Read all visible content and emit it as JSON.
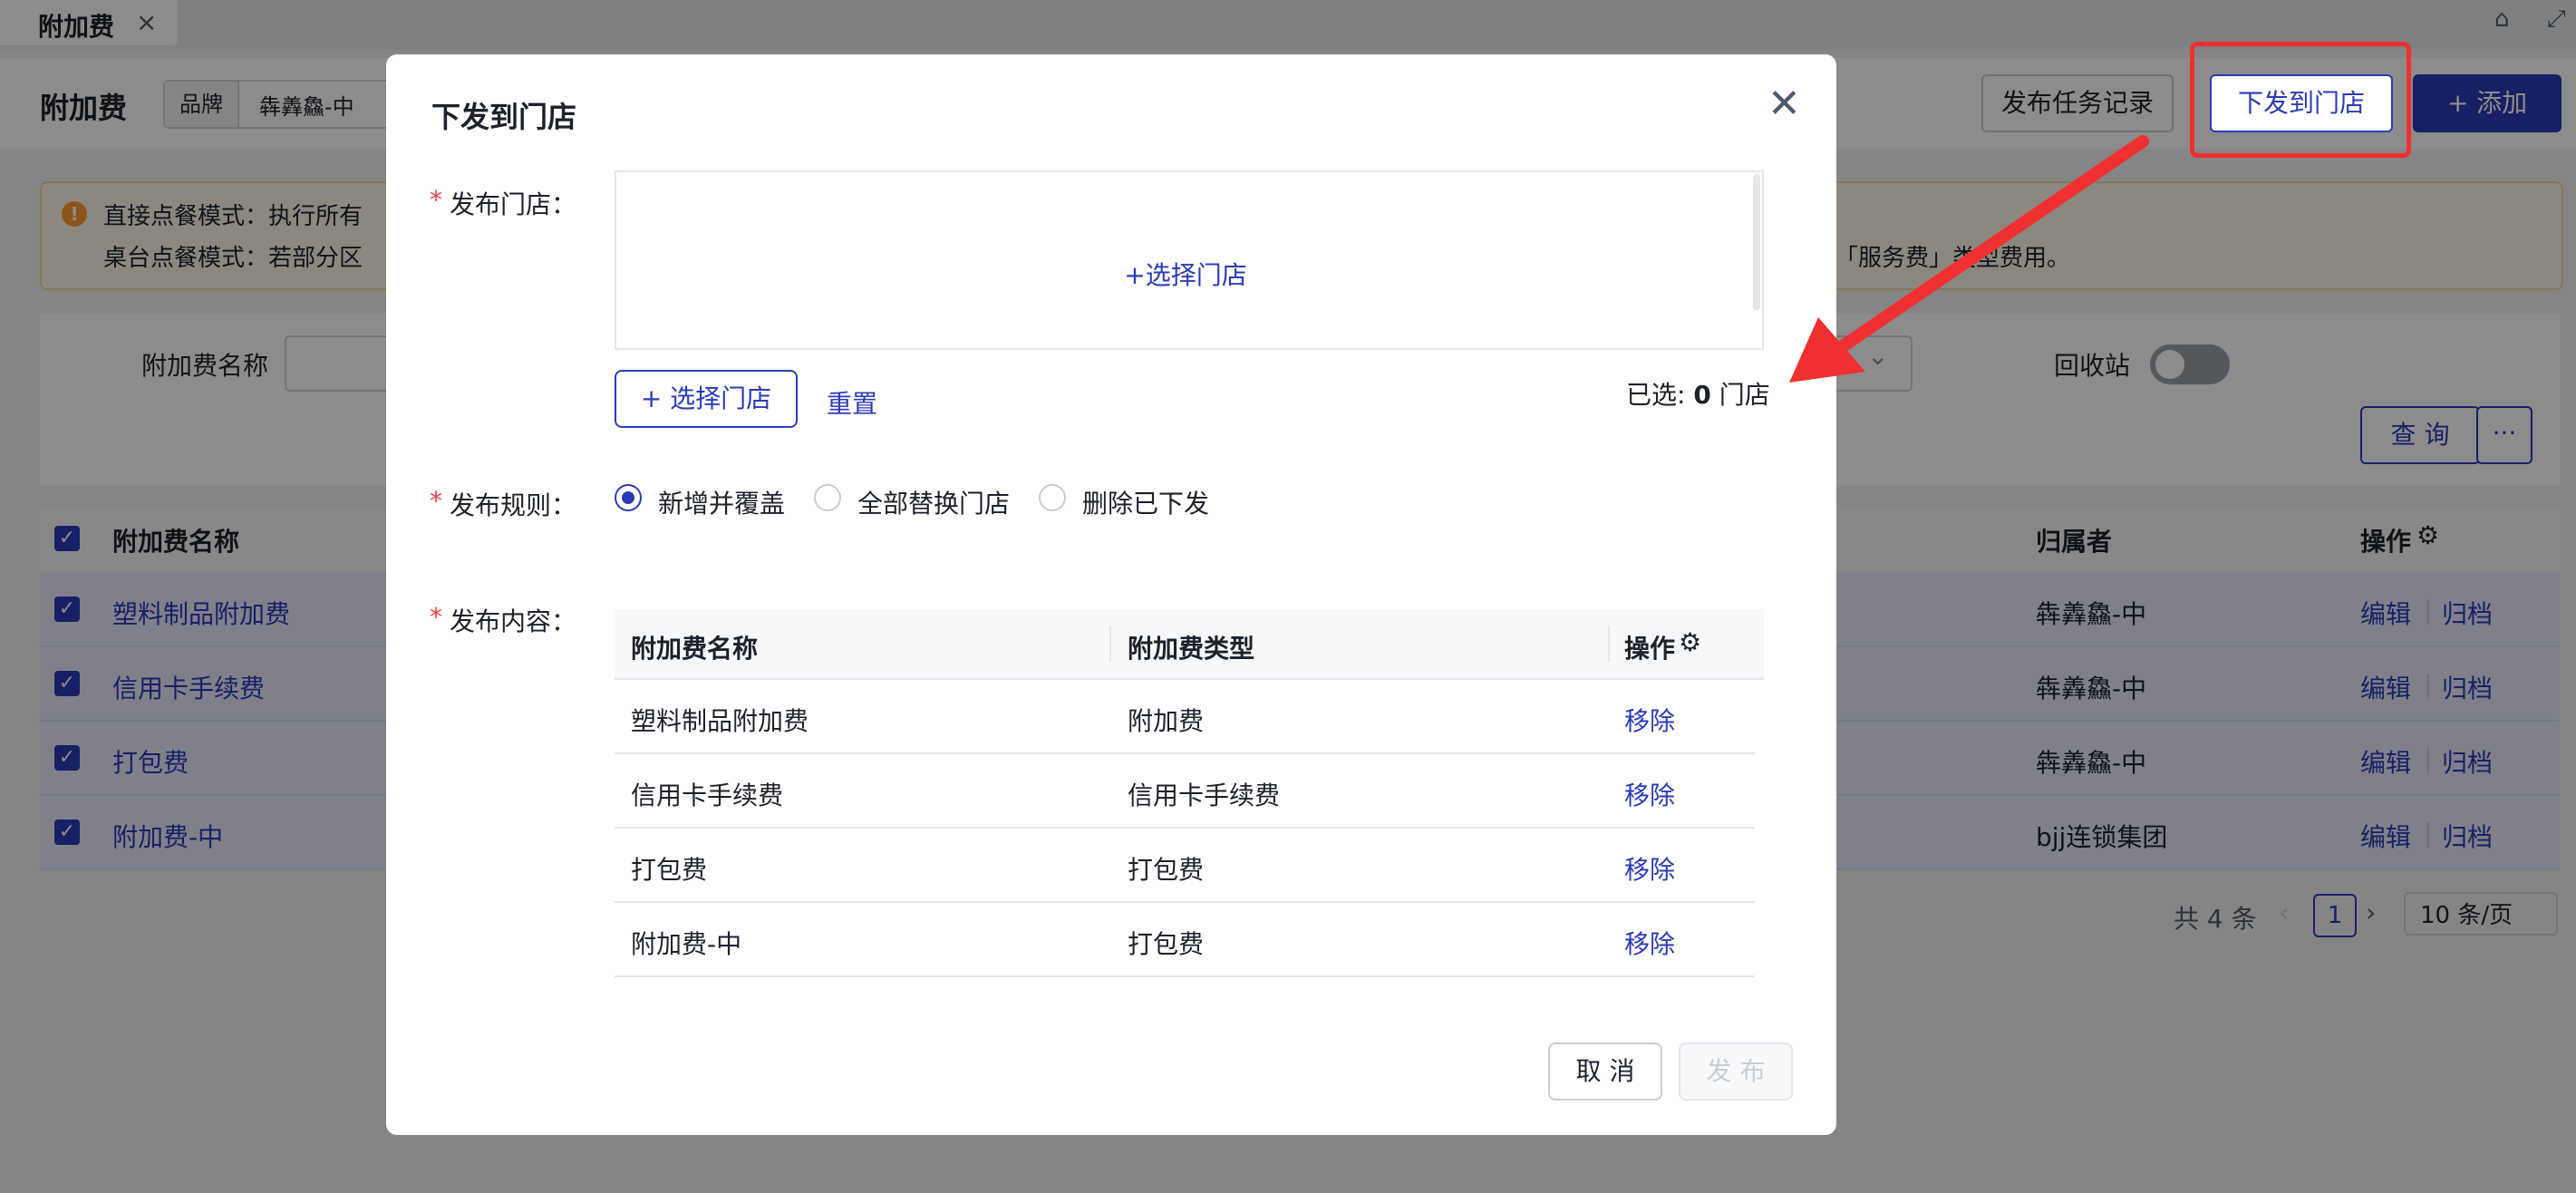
{
  "tab": {
    "label": "附加费",
    "close": "×"
  },
  "header": {
    "title": "附加费",
    "brand_label": "品牌",
    "brand_value": "犇羴鱻-中",
    "btn_history": "发布任务记录",
    "btn_distribute": "下发到门店",
    "btn_add": "+ 添加"
  },
  "alert": {
    "line1": "直接点餐模式：执行所有",
    "line2": "桌台点餐模式：若部分区",
    "line2_tail": "「服务费」类型费用。"
  },
  "filter": {
    "name_label": "附加费名称",
    "recycle_label": "回收站",
    "query_btn": "查 询",
    "more_btn": "···"
  },
  "table": {
    "col_name": "附加费名称",
    "col_owner": "归属者",
    "col_action": "操作",
    "rows": [
      {
        "name": "塑料制品附加费",
        "owner": "犇羴鱻-中",
        "edit": "编辑",
        "archive": "归档"
      },
      {
        "name": "信用卡手续费",
        "owner": "犇羴鱻-中",
        "edit": "编辑",
        "archive": "归档"
      },
      {
        "name": "打包费",
        "owner": "犇羴鱻-中",
        "edit": "编辑",
        "archive": "归档"
      },
      {
        "name": "附加费-中",
        "owner": "bjj连锁集团",
        "edit": "编辑",
        "archive": "归档"
      }
    ]
  },
  "pager": {
    "total": "共 4 条",
    "current": "1",
    "size": "10 条/页"
  },
  "modal": {
    "title": "下发到门店",
    "store_label": "发布门店：",
    "store_placeholder": "+选择门店",
    "select_btn": "+ 选择门店",
    "reset": "重置",
    "selected_prefix": "已选: ",
    "selected_count": "0",
    "selected_suffix": " 门店",
    "rule_label": "发布规则：",
    "rules": [
      "新增并覆盖",
      "全部替换门店",
      "删除已下发"
    ],
    "content_label": "发布内容：",
    "content_table": {
      "col_name": "附加费名称",
      "col_type": "附加费类型",
      "col_action": "操作",
      "rows": [
        {
          "name": "塑料制品附加费",
          "type": "附加费",
          "action": "移除"
        },
        {
          "name": "信用卡手续费",
          "type": "信用卡手续费",
          "action": "移除"
        },
        {
          "name": "打包费",
          "type": "打包费",
          "action": "移除"
        },
        {
          "name": "附加费-中",
          "type": "打包费",
          "action": "移除"
        }
      ]
    },
    "cancel": "取 消",
    "publish": "发 布"
  },
  "colors": {
    "primary": "#2b3bb8",
    "highlight": "#f03030",
    "required": "#f53f3f"
  }
}
